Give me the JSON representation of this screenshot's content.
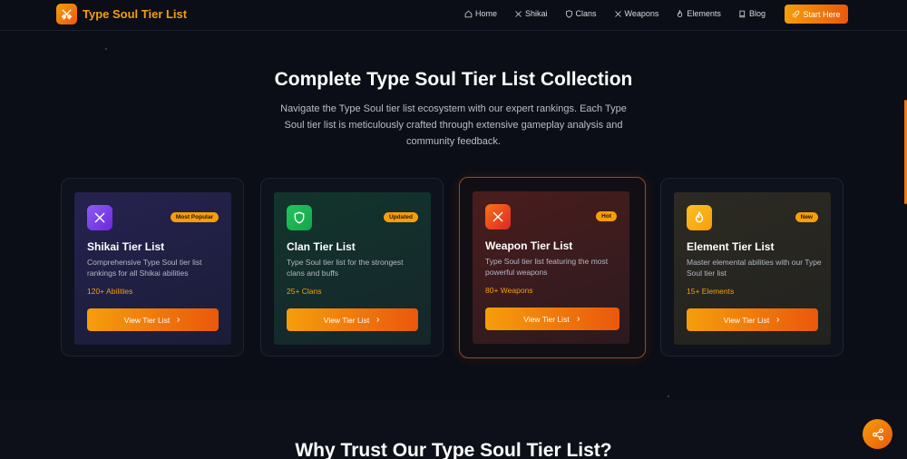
{
  "header": {
    "brand": "Type Soul Tier List",
    "logo_icon": "crossed-swords-icon",
    "nav": [
      {
        "label": "Home",
        "icon": "home-icon"
      },
      {
        "label": "Shikai",
        "icon": "crossed-swords-icon"
      },
      {
        "label": "Clans",
        "icon": "shield-icon"
      },
      {
        "label": "Weapons",
        "icon": "crossed-swords-icon"
      },
      {
        "label": "Elements",
        "icon": "flame-icon"
      },
      {
        "label": "Blog",
        "icon": "book-icon"
      }
    ],
    "cta": "Start Here",
    "cta_icon": "rocket-icon"
  },
  "hero": {
    "title": "Complete Type Soul Tier List Collection",
    "description": "Navigate the Type Soul tier list ecosystem with our expert rankings. Each Type Soul tier list is meticulously crafted through extensive gameplay analysis and community feedback."
  },
  "cards": [
    {
      "title": "Shikai Tier List",
      "badge": "Most Popular",
      "description": "Comprehensive Type Soul tier list rankings for all Shikai abilities",
      "count": "120+ Abilities",
      "button": "View Tier List",
      "icon": "crossed-swords-icon",
      "icon_color": "#8b5cf6"
    },
    {
      "title": "Clan Tier List",
      "badge": "Updated",
      "description": "Type Soul tier list for the strongest clans and buffs",
      "count": "25+ Clans",
      "button": "View Tier List",
      "icon": "shield-icon",
      "icon_color": "#22c55e"
    },
    {
      "title": "Weapon Tier List",
      "badge": "Hot",
      "description": "Type Soul tier list featuring the most powerful weapons",
      "count": "80+ Weapons",
      "button": "View Tier List",
      "icon": "crossed-swords-icon",
      "icon_color": "#f97316"
    },
    {
      "title": "Element Tier List",
      "badge": "New",
      "description": "Master elemental abilities with our Type Soul tier list",
      "count": "15+ Elements",
      "button": "View Tier List",
      "icon": "flame-icon",
      "icon_color": "#f59e0b"
    }
  ],
  "trust_section": {
    "title": "Why Trust Our Type Soul Tier List?"
  },
  "share_button": {
    "icon": "share-icon"
  },
  "colors": {
    "accent": "#f59e0b",
    "accent_dark": "#ea580c",
    "background": "#0b0e16"
  }
}
